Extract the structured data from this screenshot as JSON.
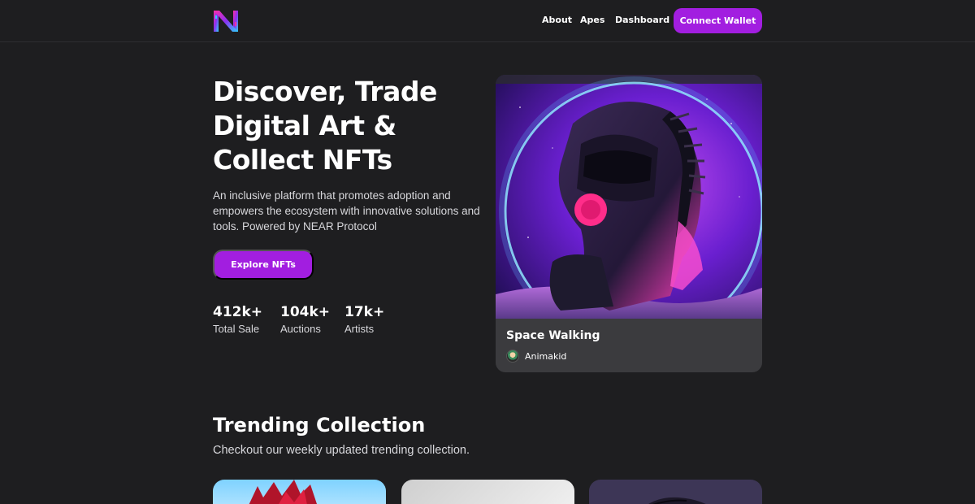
{
  "header": {
    "logo_icon": "brand-logo-icon",
    "nav": [
      {
        "label": "About"
      },
      {
        "label": "Apes"
      },
      {
        "label": "Dashboard"
      }
    ],
    "connect_label": "Connect Wallet"
  },
  "hero": {
    "title": "Discover, Trade\nDigital Art &\nCollect NFTs",
    "description": "An inclusive platform that promotes adoption and empowers the ecosystem with innovative solutions and tools. Powered by NEAR Protocol",
    "cta_label": "Explore NFTs",
    "stats": [
      {
        "value": "412k+",
        "label": "Total Sale"
      },
      {
        "value": "104k+",
        "label": "Auctions"
      },
      {
        "value": "17k+",
        "label": "Artists"
      }
    ]
  },
  "featured": {
    "title": "Space Walking",
    "artist": "Animakid"
  },
  "trending": {
    "title": "Trending Collection",
    "subtitle": "Checkout our weekly updated trending collection."
  },
  "colors": {
    "background": "#1e1e20",
    "accent": "#a21ee0",
    "card": "#3b3b3e"
  }
}
